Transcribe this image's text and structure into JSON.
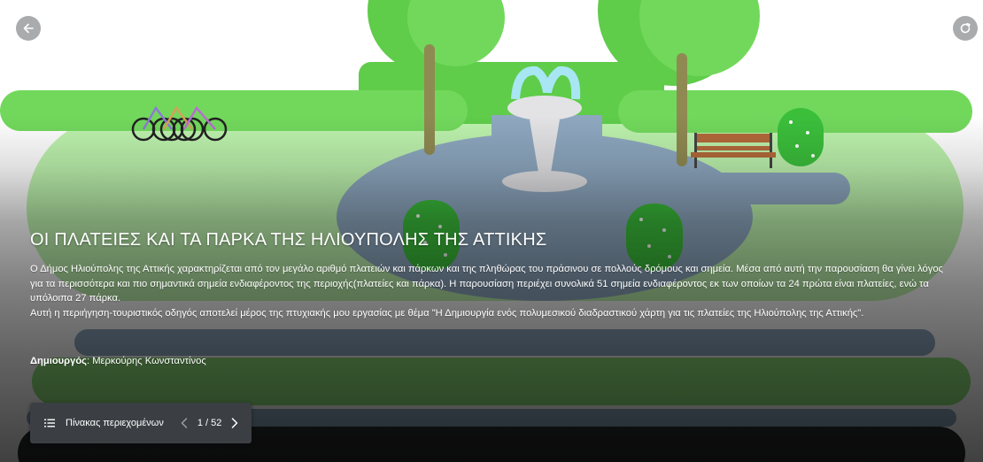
{
  "story": {
    "title": "ΟΙ ΠΛΑΤΕΙΕΣ ΚΑΙ ΤΑ ΠΑΡΚΑ ΤΗΣ ΗΛΙΟΥΠΟΛΗΣ ΤΗΣ ΑΤΤΙΚΗΣ",
    "description": [
      "Ο Δήμος Ηλιούπολης της Αττικής χαρακτηρίζεται από τον μεγάλο αριθμό πλατειών και πάρκων και της πληθώρας του πράσινου σε πολλούς δρόμους και σημεία. Μέσα από αυτή την παρουσίαση θα γίνει λόγος για τα περισσότερα και πιο σημαντικά σημεία ενδιαφέροντος της περιοχής(πλατείες και πάρκα). Η παρουσίαση περιέχει συνολικά 51 σημεία ενδιαφέροντος εκ των οποίων τα 24 πρώτα είναι πλατείες, ενώ τα υπόλοιπα 27 πάρκα.",
      "Αυτή η περιήγηση-τουριστικός οδηγός αποτελεί μέρος της πτυχιακής μου εργασίας με θέμα \"Η Δημιουργία ενός πολυμεσικού διαδραστικού χάρτη για τις πλατείες της Ηλιούπολης της Αττικής\"."
    ],
    "author_label": "Δημιουργός",
    "author_sep": ": ",
    "author_name": "Μερκούρης Κωνσταντίνος"
  },
  "nav": {
    "toc_label": "Πίνακας περιεχομένων",
    "page_counter": "1 / 52",
    "icons": {
      "back": "arrow-left-icon",
      "restart": "restart-icon",
      "toc": "list-icon",
      "prev": "chevron-left-icon",
      "next": "chevron-right-icon"
    }
  },
  "colors": {
    "grass_light": "#b8f0a8",
    "grass": "#8ee07a",
    "tree_green": "#5fcc4a",
    "trunk": "#8f8a52",
    "path": "#8ea8c0",
    "water": "#a7e6f2",
    "fountain_stone": "#e3e3e6",
    "toc_bar": "#3b3f44",
    "button_gray": "#a9abad"
  }
}
